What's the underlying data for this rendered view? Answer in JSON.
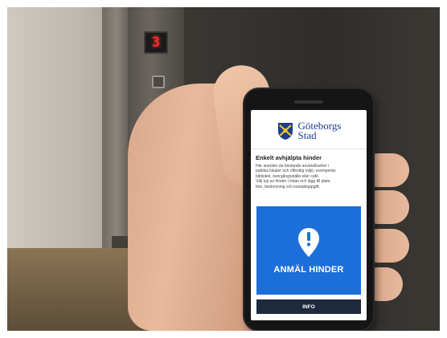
{
  "scene": {
    "elevator_floor_display": "3"
  },
  "app": {
    "brand_line1": "Göteborgs",
    "brand_line2": "Stad",
    "heading": "Enkelt avhjälpta hinder",
    "body_line1": "Här anmäler du bristande användbarhet i",
    "body_line2": "publika lokaler och offentlig miljö, exempelvis",
    "body_line3": "bibliotek, övergångsställe eller café.",
    "body_line4": "Välj typ av hinder i listan och lägg till plats,",
    "body_line5": "foto, beskrivning och kontaktuppgift.",
    "report_button_label": "ANMÄL HINDER",
    "info_button_label": "INFO",
    "colors": {
      "brand_blue": "#1b3f8b",
      "report_tile": "#1c6fd8",
      "info_bar": "#1d2a3d"
    },
    "icons": {
      "report_tile": "location-pin-exclamation-icon",
      "logo": "city-crest-icon"
    }
  }
}
